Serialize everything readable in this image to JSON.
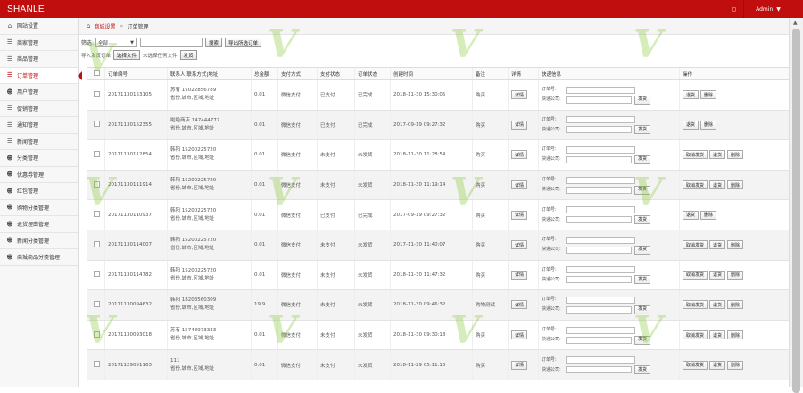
{
  "header": {
    "brand": "SHANLE",
    "user": "Admin",
    "monitor_icon": "monitor-icon"
  },
  "sidebar": {
    "items": [
      {
        "label": "网站设置",
        "icon": "home-icon"
      },
      {
        "label": "商家管理",
        "icon": "list-icon"
      },
      {
        "label": "商品管理",
        "icon": "list-icon"
      },
      {
        "label": "订单管理",
        "icon": "list-icon",
        "active": true
      },
      {
        "label": "用户管理",
        "icon": "users-icon"
      },
      {
        "label": "促销管理",
        "icon": "list-icon"
      },
      {
        "label": "通知管理",
        "icon": "list-icon"
      },
      {
        "label": "新闻管理",
        "icon": "list-icon"
      },
      {
        "label": "分类管理",
        "icon": "users-icon"
      },
      {
        "label": "优惠券管理",
        "icon": "users-icon"
      },
      {
        "label": "红包管理",
        "icon": "users-icon"
      },
      {
        "label": "购物分类管理",
        "icon": "users-icon"
      },
      {
        "label": "退货理由管理",
        "icon": "users-icon"
      },
      {
        "label": "新闻分类管理",
        "icon": "users-icon"
      },
      {
        "label": "商城商品分类管理",
        "icon": "users-icon"
      }
    ]
  },
  "breadcrumb": {
    "parent": "商城设置",
    "current": "订单管理"
  },
  "filters": {
    "label": "筛选:",
    "select_value": "全部",
    "search_button": "搜索",
    "export_button": "导出所选订单",
    "import_label": "导入发货订单",
    "choose_file_button": "选择文件",
    "no_file_text": "未选择任何文件",
    "upload_button": "发货"
  },
  "table": {
    "headers": [
      "",
      "订单编号",
      "联系人|联系方式|地址",
      "总金额",
      "支付方式",
      "支付状态",
      "订单状态",
      "创建时间",
      "备注",
      "详情",
      "快递信息",
      "操作"
    ],
    "detail_label": "详情",
    "tracking_label": "订单号:",
    "courier_label": "快递公司:",
    "ship_button": "发货",
    "rows": [
      {
        "id": "20171130153105",
        "contact": "苏有 15022856789",
        "addr": "省份,城市,区域,地址",
        "amount": "0.01",
        "pay_method": "微信支付",
        "pay_status": "已支付",
        "order_status": "已完成",
        "created": "2018-11-30 15:30:05",
        "note": "购买",
        "ops": [
          "退货",
          "删除"
        ]
      },
      {
        "id": "20171130152355",
        "contact": "啦啦商店 147444777",
        "addr": "省份,城市,区域,地址",
        "amount": "0.01",
        "pay_method": "微信支付",
        "pay_status": "已支付",
        "order_status": "已完成",
        "created": "2017-09-19 09:27:32",
        "note": "购买",
        "ops": [
          "退货",
          "删除"
        ]
      },
      {
        "id": "20171130112854",
        "contact": "韩阳 15200225720",
        "addr": "省份,城市,区域,地址",
        "amount": "0.01",
        "pay_method": "微信支付",
        "pay_status": "未支付",
        "order_status": "未发货",
        "created": "2018-11-30 11:28:54",
        "note": "购买",
        "ops": [
          "取消发货",
          "退货",
          "删除"
        ]
      },
      {
        "id": "20171130111914",
        "contact": "韩阳 15200225720",
        "addr": "省份,城市,区域,地址",
        "amount": "0.01",
        "pay_method": "微信支付",
        "pay_status": "未支付",
        "order_status": "未发货",
        "created": "2018-11-30 11:19:14",
        "note": "购买",
        "ops": [
          "取消发货",
          "退货",
          "删除"
        ]
      },
      {
        "id": "20171130110937",
        "contact": "韩阳 15200225720",
        "addr": "省份,城市,区域,地址",
        "amount": "0.01",
        "pay_method": "微信支付",
        "pay_status": "已支付",
        "order_status": "已完成",
        "created": "2017-09-19 09:27:32",
        "note": "购买",
        "ops": [
          "退货",
          "删除"
        ]
      },
      {
        "id": "20171130114007",
        "contact": "韩阳 15200225720",
        "addr": "省份,城市,区域,地址",
        "amount": "0.01",
        "pay_method": "微信支付",
        "pay_status": "未支付",
        "order_status": "未发货",
        "created": "2017-11-30 11:40:07",
        "note": "购买",
        "ops": [
          "取消发货",
          "退货",
          "删除"
        ]
      },
      {
        "id": "20171130114782",
        "contact": "韩阳 15200225720",
        "addr": "省份,城市,区域,地址",
        "amount": "0.01",
        "pay_method": "微信支付",
        "pay_status": "未支付",
        "order_status": "未发货",
        "created": "2018-11-30 11:47:32",
        "note": "购买",
        "ops": [
          "取消发货",
          "退货",
          "删除"
        ]
      },
      {
        "id": "20171130094632",
        "contact": "韩阳 18203560309",
        "addr": "省份,城市,区域,地址",
        "amount": "19.9",
        "pay_method": "微信支付",
        "pay_status": "未支付",
        "order_status": "未发货",
        "created": "2018-11-30 09:46:32",
        "note": "购物测试",
        "ops": [
          "取消发货",
          "退货",
          "删除"
        ]
      },
      {
        "id": "20171130093018",
        "contact": "苏有 15748973333",
        "addr": "省份,城市,区域,地址",
        "amount": "0.01",
        "pay_method": "微信支付",
        "pay_status": "未支付",
        "order_status": "未发货",
        "created": "2018-11-30 09:30:18",
        "note": "购买",
        "ops": [
          "取消发货",
          "退货",
          "删除"
        ]
      },
      {
        "id": "20171129051163",
        "contact": "111",
        "addr": "省份,城市,区域,地址",
        "amount": "0.01",
        "pay_method": "微信支付",
        "pay_status": "未支付",
        "order_status": "未发货",
        "created": "2018-11-29 05:11:16",
        "note": "购买",
        "ops": [
          "取消发货",
          "退货",
          "删除"
        ]
      }
    ]
  },
  "colors": {
    "brand_red": "#c00d0d"
  }
}
